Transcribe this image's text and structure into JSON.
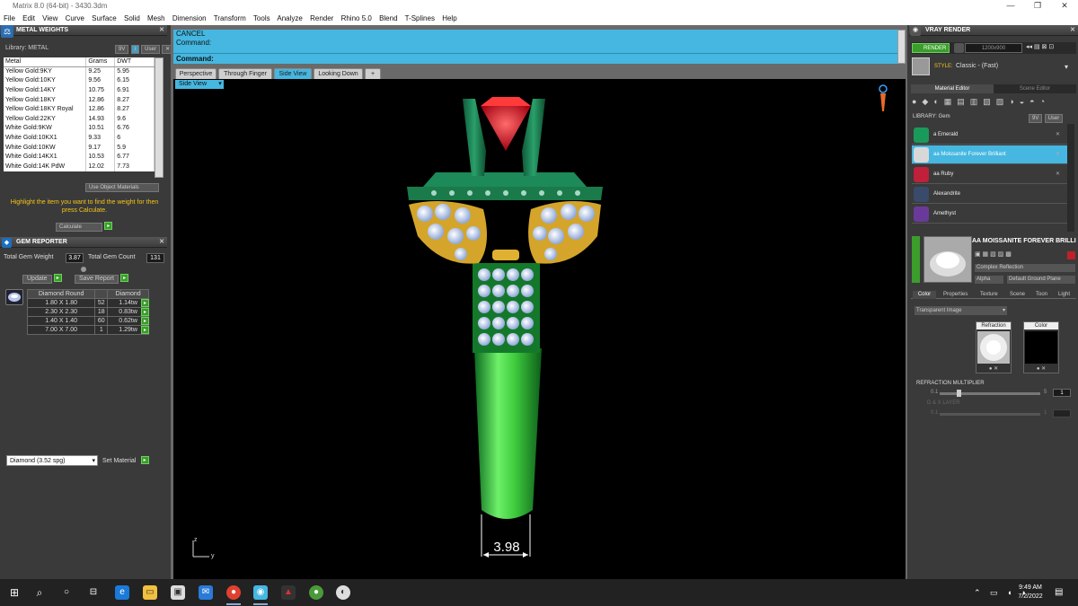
{
  "window": {
    "title": "Matrix 8.0 (64-bit) - 3430.3dm",
    "minimize": "—",
    "maximize": "❐",
    "close": "✕"
  },
  "menu": [
    "File",
    "Edit",
    "View",
    "Curve",
    "Surface",
    "Solid",
    "Mesh",
    "Dimension",
    "Transform",
    "Tools",
    "Analyze",
    "Render",
    "Rhino 5.0",
    "Blend",
    "T-Splines",
    "Help"
  ],
  "metal_weights": {
    "title": "METAL WEIGHTS",
    "library_label": "Library: METAL",
    "lib_buttons": [
      "9V",
      "User"
    ],
    "columns": [
      "Metal",
      "Grams",
      "DWT"
    ],
    "rows": [
      [
        "Yellow Gold:9KY",
        "9.25",
        "5.95"
      ],
      [
        "Yellow Gold:10KY",
        "9.56",
        "6.15"
      ],
      [
        "Yellow Gold:14KY",
        "10.75",
        "6.91"
      ],
      [
        "Yellow Gold:18KY",
        "12.86",
        "8.27"
      ],
      [
        "Yellow Gold:18KY Royal",
        "12.86",
        "8.27"
      ],
      [
        "Yellow Gold:22KY",
        "14.93",
        "9.6"
      ],
      [
        "White Gold:9KW",
        "10.51",
        "6.76"
      ],
      [
        "White Gold:10KX1",
        "9.33",
        "6"
      ],
      [
        "White Gold:10KW",
        "9.17",
        "5.9"
      ],
      [
        "White Gold:14KX1",
        "10.53",
        "6.77"
      ],
      [
        "White Gold:14K PdW",
        "12.02",
        "7.73"
      ]
    ],
    "use_object_materials": "Use Object Materials",
    "hint": "Highlight the item you want to find the weight for then press Calculate.",
    "calculate": "Calculate"
  },
  "gem_reporter": {
    "title": "GEM REPORTER",
    "total_weight_label": "Total Gem Weight",
    "total_weight": "3.87",
    "total_count_label": "Total Gem Count",
    "total_count": "131",
    "update": "Update",
    "save_report": "Save Report",
    "columns": [
      "Diamond Round",
      "",
      "Diamond"
    ],
    "rows": [
      [
        "1.80 X 1.80",
        "52",
        "1.14tw"
      ],
      [
        "2.30 X 2.30",
        "18",
        "0.83tw"
      ],
      [
        "1.40 X 1.40",
        "60",
        "0.62tw"
      ],
      [
        "7.00 X 7.00",
        "1",
        "1.29tw"
      ]
    ],
    "material_select": "Diamond    (3.52 spg)",
    "set_material": "Set Material"
  },
  "command": {
    "line1": "CANCEL",
    "line2": "Command:",
    "prompt": "Command:"
  },
  "view_tabs": [
    "Perspective",
    "Through Finger",
    "Side View",
    "Looking Down",
    "+"
  ],
  "active_view": "Side View",
  "dimension_value": "3.98",
  "axis": {
    "z": "z",
    "y": "y"
  },
  "vray": {
    "title": "VRAY RENDER",
    "render_btn": "RENDER",
    "resolution": "1200x900",
    "style_label": "STYLE:",
    "style_value": "Classic - (Fast)",
    "tabs": [
      "Material Editor",
      "Scene Editor"
    ],
    "library_label": "LIBRARY: Gem",
    "lib_buttons": [
      "9V",
      "User"
    ],
    "materials": [
      {
        "name": "a Emerald",
        "color": "#1a9a5a"
      },
      {
        "name": "aa Moissanite Forever Brilliant",
        "color": "#d8d8d8"
      },
      {
        "name": "aa Ruby",
        "color": "#c0203a"
      },
      {
        "name": "Alexandrite",
        "color": "#3a4a6a"
      },
      {
        "name": "Amethyst",
        "color": "#6a3a9a"
      }
    ],
    "selected_material_title": "AA MOISSANITE FOREVER BRILLIANT",
    "reflection": "Complex Reflection",
    "alpha": "Alpha",
    "ground": "Default Ground Plane",
    "sub_tabs": [
      "Color",
      "Properties",
      "Texture",
      "Scene",
      "Toon",
      "Light"
    ],
    "transparent": "Transparent Image",
    "refraction": "Refraction",
    "color": "Color",
    "refraction_multiplier": "REFRACTION MULTIPLIER",
    "slider_min": "0.1",
    "slider_max": "5",
    "slider_value": "1",
    "slider2_label": "D & X  LAYER",
    "slider2_min": "0.1",
    "slider2_max": "1"
  },
  "taskbar": {
    "time": "9:49 AM",
    "date": "7/2/2022",
    "search": "⌕",
    "start": "⊞"
  }
}
